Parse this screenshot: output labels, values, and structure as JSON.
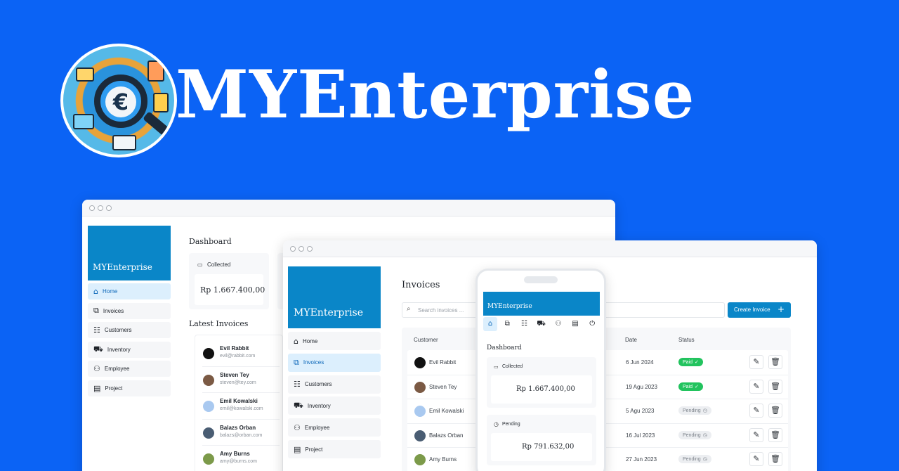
{
  "hero": {
    "title": "MYEnterprise"
  },
  "brand": {
    "name": "MYEnterprise"
  },
  "nav": {
    "items": [
      {
        "label": "Home",
        "icon": "home-icon",
        "glyph": "⌂"
      },
      {
        "label": "Invoices",
        "icon": "invoices-icon",
        "glyph": "⧉"
      },
      {
        "label": "Customers",
        "icon": "customers-icon",
        "glyph": "☷"
      },
      {
        "label": "Inventory",
        "icon": "truck-icon",
        "glyph": "⛟"
      },
      {
        "label": "Employee",
        "icon": "users-icon",
        "glyph": "⚇"
      },
      {
        "label": "Project",
        "icon": "table-icon",
        "glyph": "▤"
      }
    ]
  },
  "dashboard": {
    "title": "Dashboard",
    "collected": {
      "label": "Collected",
      "value": "Rp 1.667.400,00"
    },
    "pending": {
      "label": "Pending",
      "value": "Rp 791.632,00"
    },
    "latest_title": "Latest Invoices",
    "latest": [
      {
        "name": "Evil Rabbit",
        "email": "evil@rabbit.com",
        "avatar": "#111111"
      },
      {
        "name": "Steven Tey",
        "email": "steven@tey.com",
        "avatar": "#7b5a44"
      },
      {
        "name": "Emil Kowalski",
        "email": "emil@kowalski.com",
        "avatar": "#a9c9f0"
      },
      {
        "name": "Balazs Orban",
        "email": "balazs@orban.com",
        "avatar": "#4a5d73"
      },
      {
        "name": "Amy Burns",
        "email": "amy@burns.com",
        "avatar": "#7c9a4a"
      }
    ]
  },
  "invoices": {
    "title": "Invoices",
    "search_placeholder": "Search invoices ...",
    "create_label": "Create Invoice",
    "columns": {
      "customer": "Customer",
      "date": "Date",
      "status": "Status"
    },
    "rows": [
      {
        "customer": "Evil Rabbit",
        "date": "6 Jun 2024",
        "status": "Paid",
        "status_type": "paid",
        "avatar": "#111111"
      },
      {
        "customer": "Steven Tey",
        "date": "19 Agu 2023",
        "status": "Paid",
        "status_type": "paid",
        "avatar": "#7b5a44"
      },
      {
        "customer": "Emil Kowalski",
        "date": "5 Agu 2023",
        "status": "Pending",
        "status_type": "pending",
        "avatar": "#a9c9f0"
      },
      {
        "customer": "Balazs Orban",
        "date": "16 Jul 2023",
        "status": "Pending",
        "status_type": "pending",
        "avatar": "#4a5d73"
      },
      {
        "customer": "Amy Burns",
        "date": "27 Jun 2023",
        "status": "Pending",
        "status_type": "pending",
        "avatar": "#7c9a4a"
      }
    ]
  },
  "colors": {
    "background": "#0b63f5",
    "brand": "#0a86c8",
    "paid": "#22c35e"
  }
}
